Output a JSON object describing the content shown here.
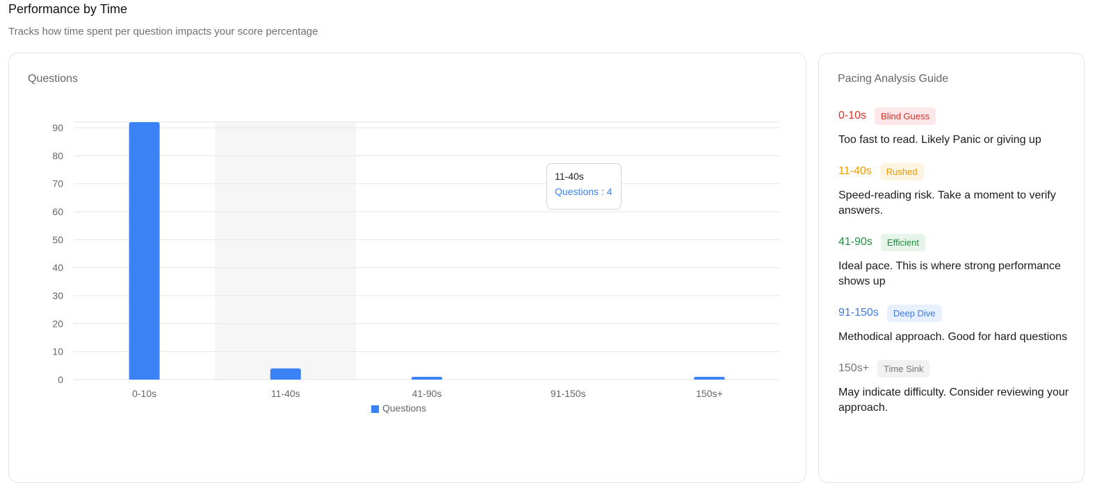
{
  "header": {
    "title": "Performance by Time",
    "subtitle": "Tracks how time spent per question impacts your score percentage"
  },
  "chart_card": {
    "title": "Questions"
  },
  "chart_data": {
    "type": "bar",
    "categories": [
      "0-10s",
      "11-40s",
      "41-90s",
      "91-150s",
      "150s+"
    ],
    "series": [
      {
        "name": "Questions",
        "values": [
          92,
          4,
          1,
          0,
          1
        ],
        "color": "#3b82f6"
      }
    ],
    "yticks": [
      0,
      10,
      20,
      30,
      40,
      50,
      60,
      70,
      80,
      90
    ],
    "ylim": [
      0,
      92
    ],
    "grid": true,
    "legend": "bottom",
    "highlighted_category": "11-40s"
  },
  "tooltip": {
    "label": "11-40s",
    "series_name": "Questions",
    "separator": " : ",
    "value": "4"
  },
  "guide": {
    "title": "Pacing Analysis Guide",
    "items": [
      {
        "range": "0-10s",
        "badge": "Blind Guess",
        "description": "Too fast to read. Likely Panic or giving up",
        "color": "#d93025",
        "badge_bg": "#fde7e9"
      },
      {
        "range": "11-40s",
        "badge": "Rushed",
        "description": "Speed-reading risk. Take a moment to verify answers.",
        "color": "#f29900",
        "badge_bg": "#fef4e2"
      },
      {
        "range": "41-90s",
        "badge": "Efficient",
        "description": "Ideal pace. This is where strong performance shows up",
        "color": "#1e8e3e",
        "badge_bg": "#e6f4ea"
      },
      {
        "range": "91-150s",
        "badge": "Deep Dive",
        "description": "Methodical approach. Good for hard questions",
        "color": "#3b78e7",
        "badge_bg": "#e8f0fe"
      },
      {
        "range": "150s+",
        "badge": "Time Sink",
        "description": "May indicate difficulty. Consider reviewing your approach.",
        "color": "#757575",
        "badge_bg": "#f1f1f1"
      }
    ]
  }
}
